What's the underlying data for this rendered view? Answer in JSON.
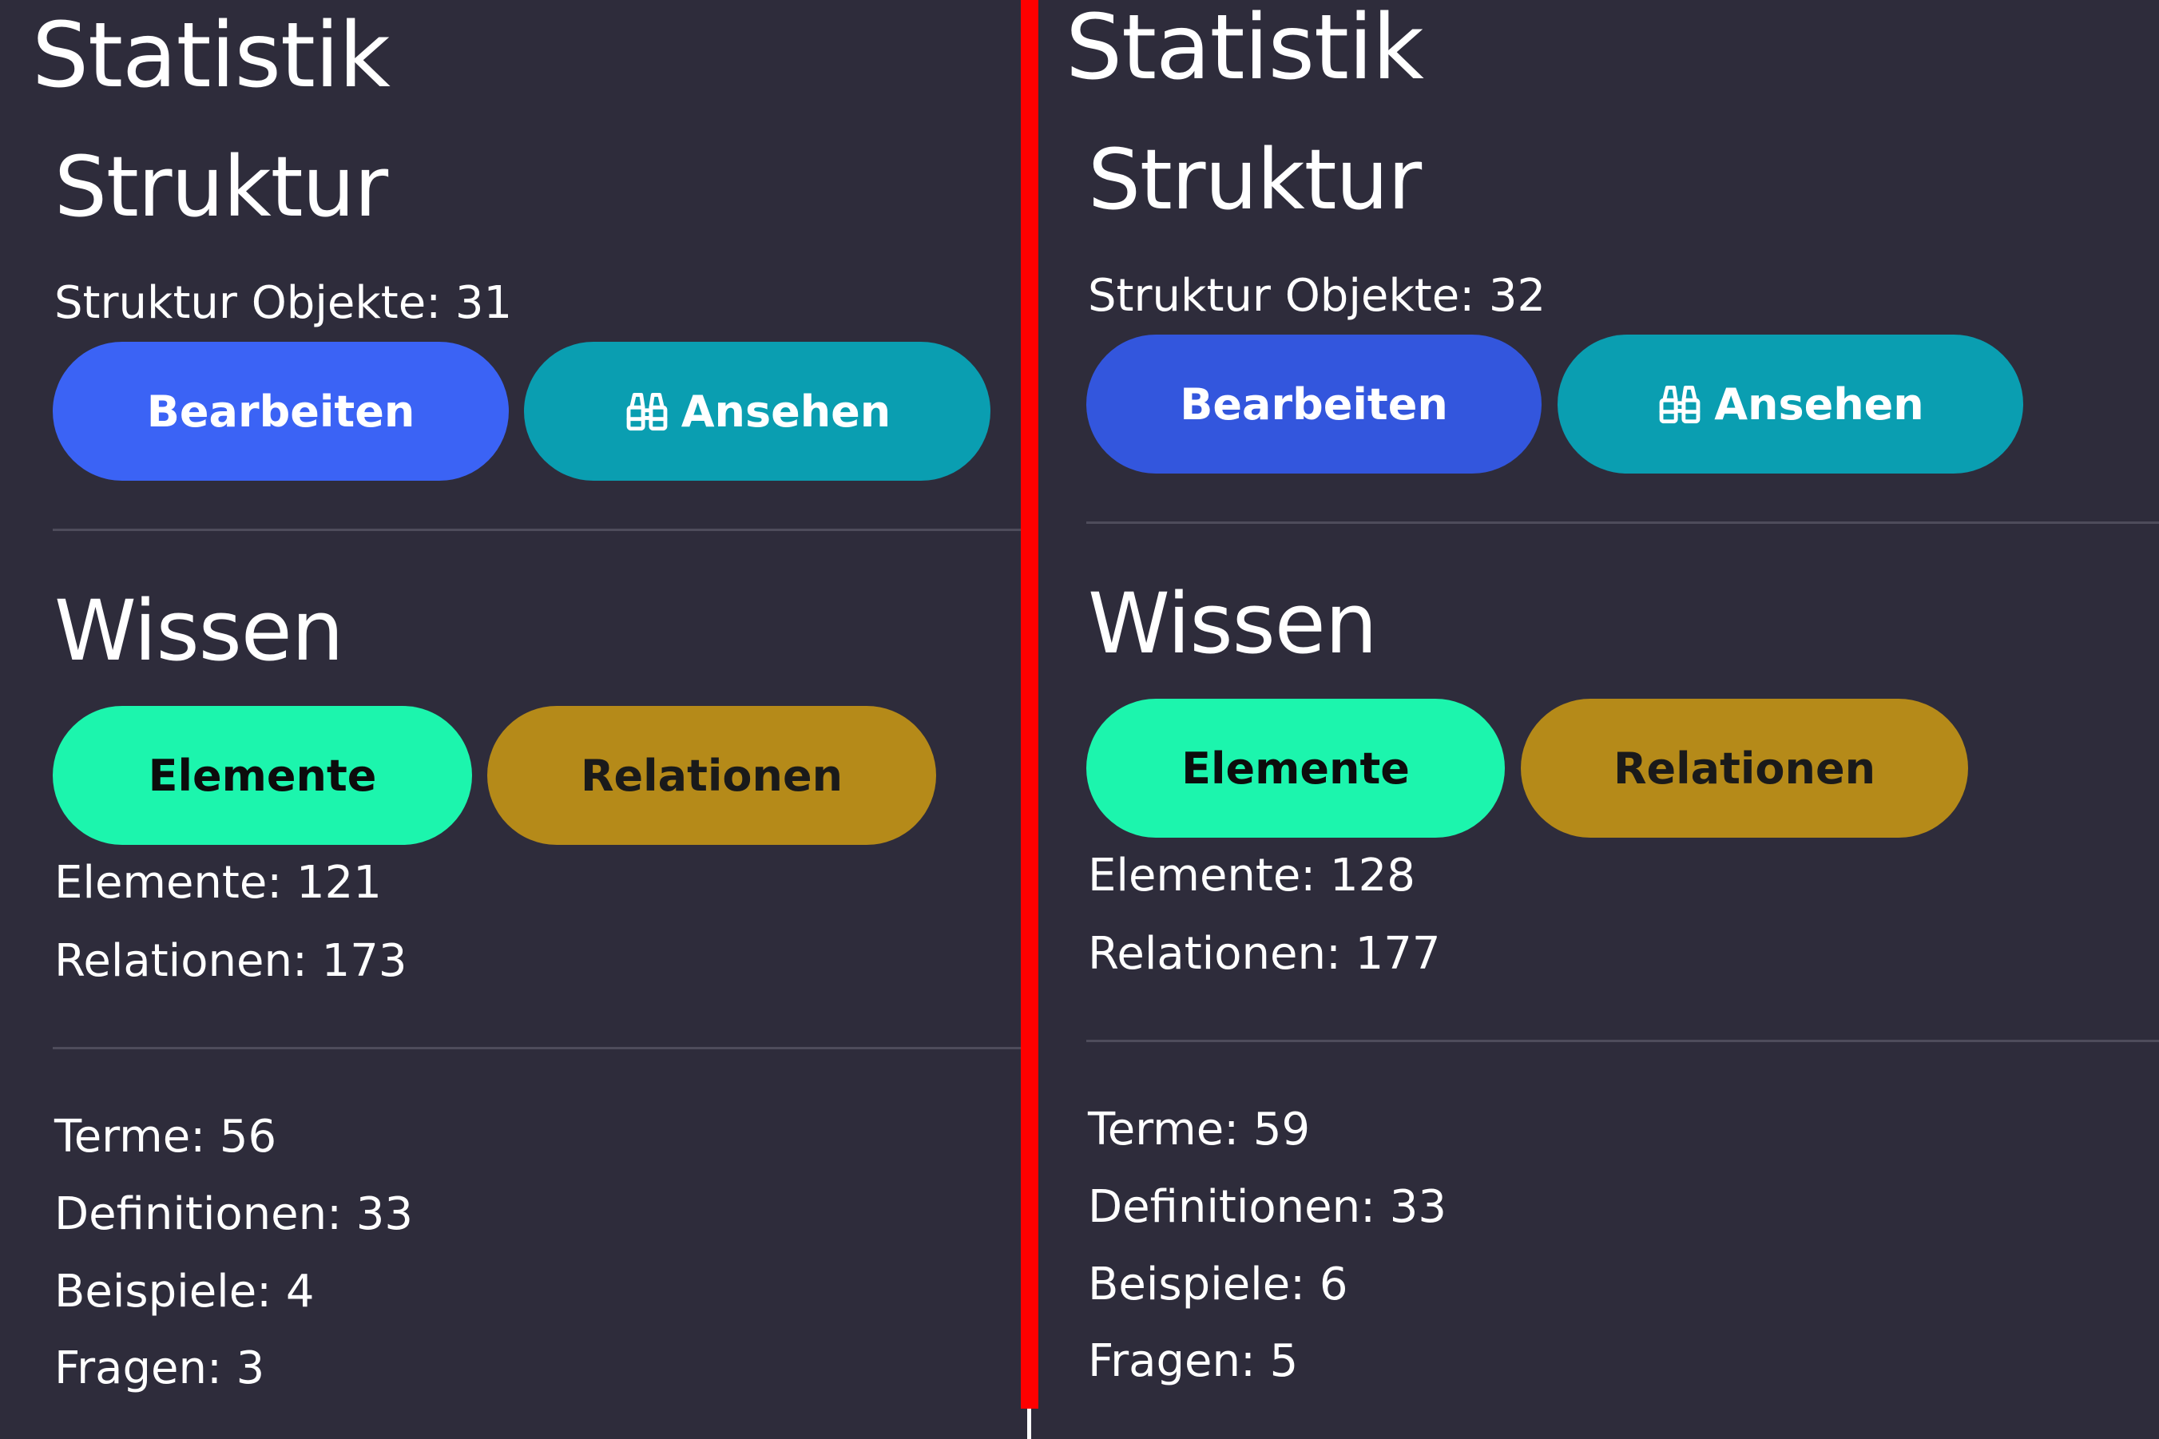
{
  "colors": {
    "background": "#2e2c3b",
    "bearbeiten_button": "#3b63f5",
    "ansehen_button": "#0a9eb1",
    "elemente_button": "#1cf5ad",
    "relationen_button": "#b58a19",
    "separator": "#ff0000"
  },
  "panels": [
    {
      "title": "Statistik",
      "struktur": {
        "heading": "Struktur",
        "objects_text": "Struktur Objekte: 31",
        "edit_label": "Bearbeiten",
        "view_label": "Ansehen",
        "view_icon": "binoculars-icon"
      },
      "wissen": {
        "heading": "Wissen",
        "elements_button": "Elemente",
        "relations_button": "Relationen",
        "elements_count": "Elemente: 121",
        "relations_count": "Relationen: 173"
      },
      "details": {
        "terme": "Terme: 56",
        "definitionen": "Definitionen: 33",
        "beispiele": "Beispiele: 4",
        "fragen": "Fragen: 3"
      }
    },
    {
      "title": "Statistik",
      "struktur": {
        "heading": "Struktur",
        "objects_text": "Struktur Objekte: 32",
        "edit_label": "Bearbeiten",
        "view_label": "Ansehen",
        "view_icon": "binoculars-icon"
      },
      "wissen": {
        "heading": "Wissen",
        "elements_button": "Elemente",
        "relations_button": "Relationen",
        "elements_count": "Elemente: 128",
        "relations_count": "Relationen: 177"
      },
      "details": {
        "terme": "Terme: 59",
        "definitionen": "Definitionen: 33",
        "beispiele": "Beispiele: 6",
        "fragen": "Fragen: 5"
      }
    }
  ]
}
